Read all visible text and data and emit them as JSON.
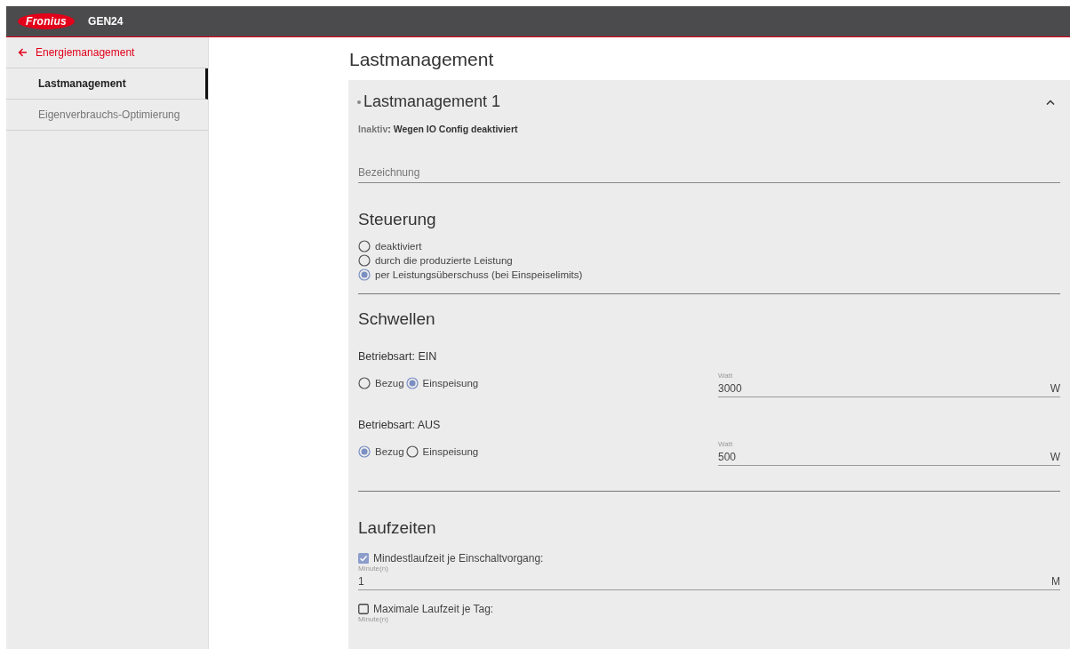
{
  "header": {
    "logo": "Fronius",
    "product": "GEN24"
  },
  "sidebar": {
    "back": {
      "label": "Energiemanagement"
    },
    "items": [
      {
        "label": "Lastmanagement",
        "selected": true
      },
      {
        "label": "Eigenverbrauchs-Optimierung",
        "selected": false
      }
    ]
  },
  "page_title": "Lastmanagement",
  "card": {
    "title": "Lastmanagement 1",
    "expanded": true,
    "status_label": "Inaktiv",
    "status_text": ": Wegen IO Config deaktiviert",
    "name_field": {
      "placeholder": "Bezeichnung"
    },
    "control": {
      "heading": "Steuerung",
      "options": [
        {
          "label": "deaktiviert",
          "selected": false
        },
        {
          "label": "durch die produzierte Leistung",
          "selected": false
        },
        {
          "label": "per Leistungsüberschuss (bei Einspeiselimits)",
          "selected": true
        }
      ]
    },
    "thresholds": {
      "heading": "Schwellen",
      "modes": [
        {
          "title": "Betriebsart: EIN",
          "options": [
            {
              "label": "Bezug",
              "selected": false
            },
            {
              "label": "Einspeisung",
              "selected": true
            }
          ],
          "field": {
            "label": "Watt",
            "value": "3000",
            "unit": "W"
          }
        },
        {
          "title": "Betriebsart: AUS",
          "options": [
            {
              "label": "Bezug",
              "selected": true
            },
            {
              "label": "Einspeisung",
              "selected": false
            }
          ],
          "field": {
            "label": "Watt",
            "value": "500",
            "unit": "W"
          }
        }
      ]
    },
    "runtimes": {
      "heading": "Laufzeiten",
      "items": [
        {
          "label": "Mindestlaufzeit je Einschaltvorgang:",
          "checked": true,
          "field": {
            "label": "Minute(n)",
            "value": "1",
            "unit": "M"
          }
        },
        {
          "label": "Maximale Laufzeit je Tag:",
          "checked": false,
          "field": {
            "label": "Minute(n)"
          }
        }
      ]
    }
  }
}
